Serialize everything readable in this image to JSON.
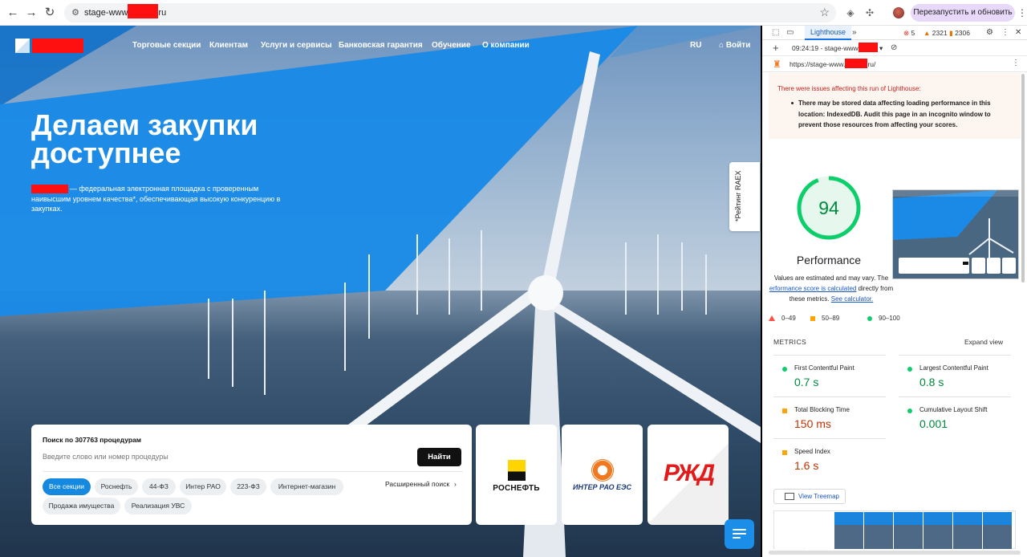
{
  "browser": {
    "url_prefix": "stage-www",
    "url_suffix": "ru",
    "relaunch_label": "Перезапустить и обновить"
  },
  "site": {
    "nav": [
      "Торговые секции",
      "Клиентам",
      "Услуги и сервисы",
      "Банковская гарантия",
      "Обучение",
      "О компании"
    ],
    "lang": "RU",
    "login": "Войти",
    "hero_title": "Делаем закупки доступнее",
    "hero_text": "— федеральная электронная площадка с проверенным наивысшим уровнем качества*, обеспечивающая высокую конкуренцию в закупках.",
    "raex_tab": "*Рейтинг RAEX",
    "search": {
      "title": "Поиск по 307763 процедурам",
      "placeholder": "Введите слово или номер процедуры",
      "button": "Найти",
      "advanced": "Расширенный поиск",
      "chips": [
        "Все секции",
        "Роснефть",
        "44-ФЗ",
        "Интер РАО",
        "223-ФЗ",
        "Интернет-магазин",
        "Продажа имущества",
        "Реализация УВС"
      ]
    },
    "partners": {
      "rosneft": "РОСНЕФТЬ",
      "interrao": "ИНТЕР РАО ЕЭС",
      "rzd": "РЖД"
    }
  },
  "devtools": {
    "tab": "Lighthouse",
    "errors": "5",
    "warnings": "2321",
    "issues": "2306",
    "report_select": "09:24:19 - stage-www",
    "report_url_prefix": "https://stage-www.",
    "report_url_suffix": "ru/",
    "warning_title": "There were issues affecting this run of Lighthouse:",
    "warning_text": "There may be stored data affecting loading performance in this location: IndexedDB. Audit this page in an incognito window to prevent those resources from affecting your scores.",
    "score": "94",
    "score_value": 94,
    "category": "Performance",
    "note_pre": "Values are estimated and may vary. The",
    "note_link1": "erformance score is calculated",
    "note_mid": "directly from these metrics.",
    "note_link2": "See calculator.",
    "legend": [
      "0–49",
      "50–89",
      "90–100"
    ],
    "metrics_heading": "METRICS",
    "expand": "Expand view",
    "metrics": [
      {
        "name": "First Contentful Paint",
        "value": "0.7 s",
        "status": "good"
      },
      {
        "name": "Largest Contentful Paint",
        "value": "0.8 s",
        "status": "good"
      },
      {
        "name": "Total Blocking Time",
        "value": "150 ms",
        "status": "average"
      },
      {
        "name": "Cumulative Layout Shift",
        "value": "0.001",
        "status": "good"
      },
      {
        "name": "Speed Index",
        "value": "1.6 s",
        "status": "average"
      }
    ],
    "treemap": "View Treemap",
    "colors": {
      "good": "#0cce6b",
      "good_text": "#008a3e",
      "average": "#ffa400",
      "average_text": "#c33300",
      "bad": "#ff4e42"
    }
  }
}
